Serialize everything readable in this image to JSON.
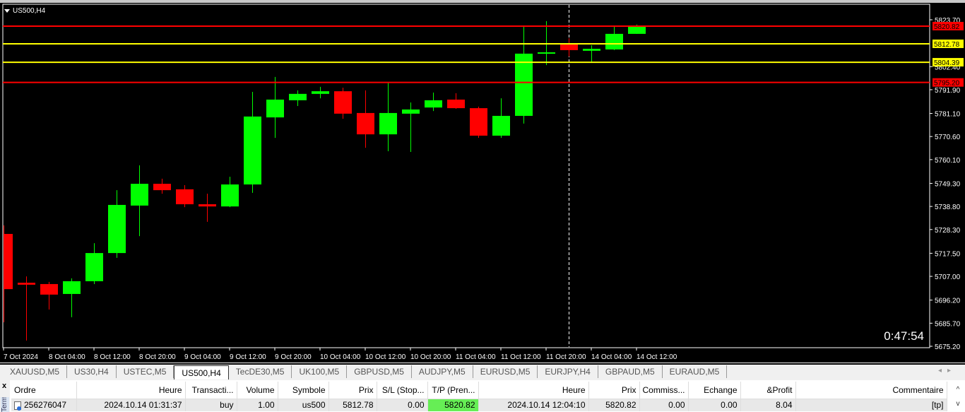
{
  "chart_header": {
    "symbol": "US500,H4"
  },
  "countdown": "0:47:54",
  "chart_data": {
    "type": "candlestick",
    "symbol": "US500",
    "timeframe": "H4",
    "ylim": [
      5675.2,
      5823.7
    ],
    "y_ticks": [
      "5823.70",
      "5802.40",
      "5791.90",
      "5781.10",
      "5770.60",
      "5760.10",
      "5749.30",
      "5738.80",
      "5728.30",
      "5717.50",
      "5707.00",
      "5696.20",
      "5685.70",
      "5675.20"
    ],
    "x_ticks": [
      "7 Oct 2024",
      "8 Oct 04:00",
      "8 Oct 12:00",
      "8 Oct 20:00",
      "9 Oct 04:00",
      "9 Oct 12:00",
      "9 Oct 20:00",
      "10 Oct 04:00",
      "10 Oct 12:00",
      "10 Oct 20:00",
      "11 Oct 04:00",
      "11 Oct 12:00",
      "11 Oct 20:00",
      "14 Oct 04:00",
      "14 Oct 12:00"
    ],
    "candles": [
      [
        5726.3,
        5730.2,
        5686.1,
        5701.2
      ],
      [
        5704.1,
        5707.0,
        5677.8,
        5703.2
      ],
      [
        5703.5,
        5704.5,
        5691.9,
        5698.7
      ],
      [
        5699.0,
        5706.1,
        5688.4,
        5704.8
      ],
      [
        5704.8,
        5722.1,
        5703.5,
        5717.6
      ],
      [
        5717.6,
        5746.2,
        5715.4,
        5739.5
      ],
      [
        5739.2,
        5757.5,
        5725.3,
        5749.1
      ],
      [
        5749.1,
        5751.4,
        5744.6,
        5746.2
      ],
      [
        5746.6,
        5748.5,
        5738.5,
        5739.8
      ],
      [
        5739.8,
        5744.6,
        5731.8,
        5738.8
      ],
      [
        5738.8,
        5752.3,
        5738.5,
        5748.8
      ],
      [
        5748.8,
        5790.9,
        5745.0,
        5779.7
      ],
      [
        5779.3,
        5797.7,
        5770.0,
        5787.4
      ],
      [
        5787.1,
        5791.6,
        5784.5,
        5790.0
      ],
      [
        5790.0,
        5793.2,
        5788.0,
        5791.2
      ],
      [
        5791.2,
        5792.8,
        5778.7,
        5781.0
      ],
      [
        5781.3,
        5791.6,
        5765.5,
        5771.6
      ],
      [
        5771.6,
        5795.4,
        5763.9,
        5781.3
      ],
      [
        5781.0,
        5786.1,
        5763.6,
        5782.9
      ],
      [
        5783.8,
        5790.6,
        5782.2,
        5787.1
      ],
      [
        5787.4,
        5790.3,
        5783.2,
        5783.5
      ],
      [
        5783.5,
        5784.2,
        5770.0,
        5771.0
      ],
      [
        5771.0,
        5788.0,
        5770.0,
        5780.0
      ],
      [
        5780.0,
        5820.8,
        5776.5,
        5808.3
      ],
      [
        5808.3,
        5823.1,
        5803.1,
        5808.9
      ],
      [
        5812.5,
        5815.3,
        5807.0,
        5809.9
      ],
      [
        5809.6,
        5812.1,
        5804.4,
        5810.5
      ],
      [
        5810.2,
        5820.5,
        5809.9,
        5817.3
      ],
      [
        5817.3,
        5821.5,
        5817.3,
        5820.5
      ]
    ],
    "hlines": [
      {
        "price": 5820.82,
        "label": "5820.82",
        "color": "#ff0000"
      },
      {
        "price": 5812.78,
        "label": "5812.78",
        "color": "#ffff00"
      },
      {
        "price": 5804.39,
        "label": "5804.39",
        "color": "#ffff00"
      },
      {
        "price": 5795.2,
        "label": "5795.20",
        "color": "#ff0000"
      }
    ],
    "colors": {
      "bull": "#00ff00",
      "bear": "#ff0000",
      "background": "#000000",
      "axis_text": "#ffffff"
    }
  },
  "tabs": [
    "XAUUSD,M5",
    "US30,H4",
    "USTEC,M5",
    "US500,H4",
    "TecDE30,M5",
    "UK100,M5",
    "GBPUSD,M5",
    "AUDJPY,M5",
    "EURUSD,M5",
    "EURJPY,H4",
    "GBPAUD,M5",
    "EURAUD,M5"
  ],
  "active_tab": "US500,H4",
  "terminal": {
    "side_label": "Terminal",
    "close": "x",
    "columns": [
      "Ordre",
      "Heure",
      "Transacti...",
      "Volume",
      "Symbole",
      "Prix",
      "S/L (Stop...",
      "T/P (Pren...",
      "Heure",
      "Prix",
      "Commiss...",
      "Echange",
      "&Profit",
      "Commentaire"
    ],
    "rows": [
      [
        "256276047",
        "2024.10.14 01:31:37",
        "buy",
        "1.00",
        "us500",
        "5812.78",
        "0.00",
        "5820.82",
        "2024.10.14 12:04:10",
        "5820.82",
        "0.00",
        "0.00",
        "8.04",
        "[tp]"
      ]
    ]
  }
}
